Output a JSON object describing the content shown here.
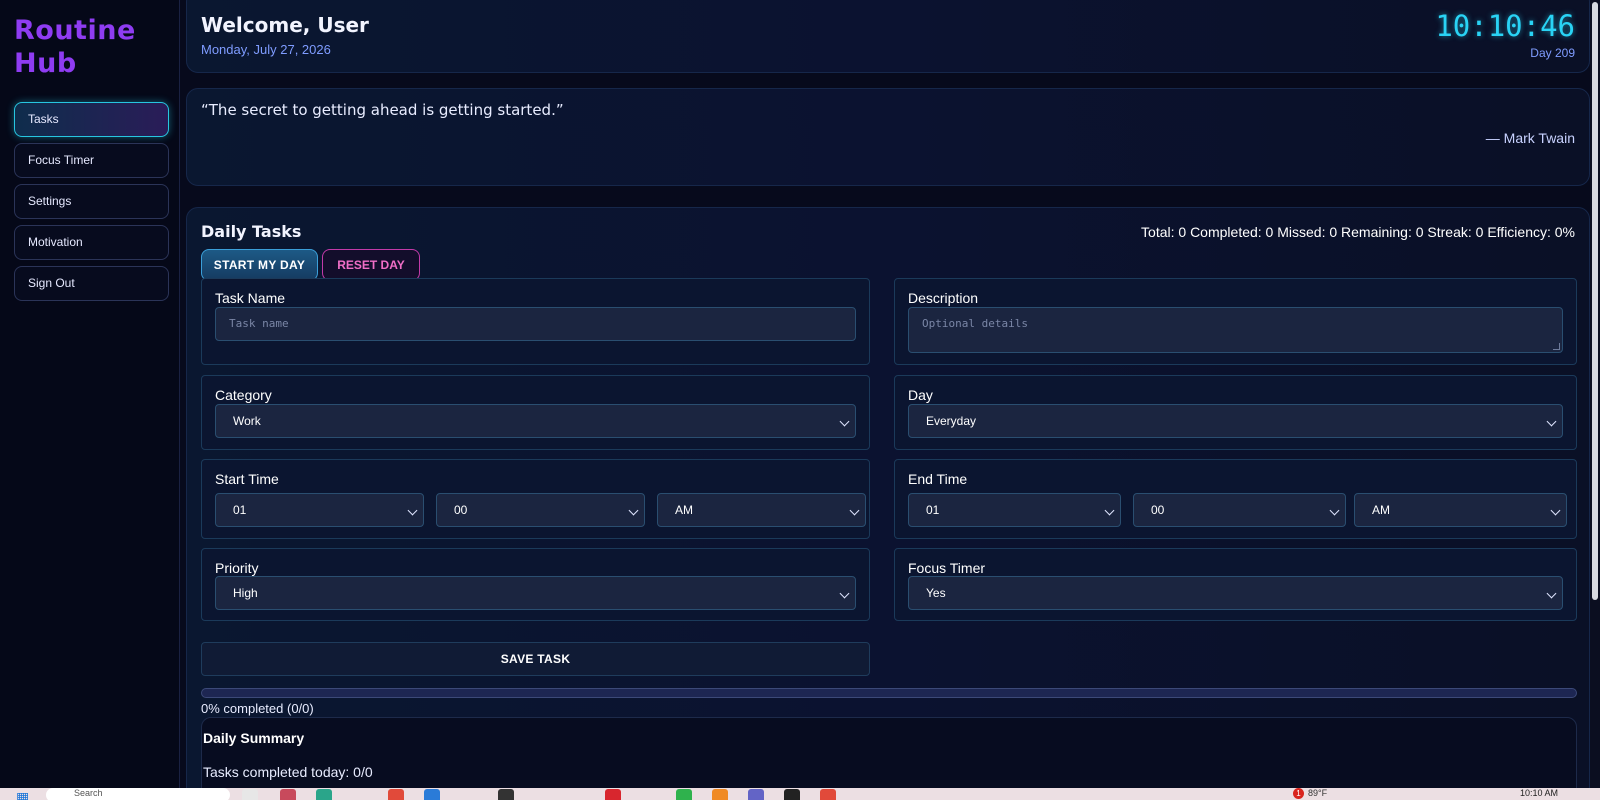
{
  "app": {
    "brand_line1": "Routine",
    "brand_line2": "Hub"
  },
  "sidebar": {
    "items": [
      {
        "label": "Tasks",
        "active": true
      },
      {
        "label": "Focus Timer"
      },
      {
        "label": "Settings"
      },
      {
        "label": "Motivation"
      },
      {
        "label": "Sign Out"
      }
    ]
  },
  "header": {
    "welcome": "Welcome, User",
    "date": "Monday, July 27, 2026",
    "clock": "10:10:46",
    "day": "Day 209"
  },
  "quote": {
    "text": "“The secret to getting ahead is getting started.”",
    "author": "— Mark Twain"
  },
  "tasks": {
    "title": "Daily Tasks",
    "stats": "Total: 0 Completed: 0 Missed: 0 Remaining: 0 Streak: 0 Efficiency: 0%",
    "start_label": "START MY DAY",
    "reset_label": "RESET DAY",
    "form": {
      "task_name": {
        "label": "Task Name",
        "placeholder": "Task name",
        "value": ""
      },
      "description": {
        "label": "Description",
        "placeholder": "Optional details",
        "value": ""
      },
      "category": {
        "label": "Category",
        "value": "Work"
      },
      "day": {
        "label": "Day",
        "value": "Everyday"
      },
      "start_time": {
        "label": "Start Time",
        "hour": "01",
        "minute": "00",
        "ampm": "AM"
      },
      "end_time": {
        "label": "End Time",
        "hour": "01",
        "minute": "00",
        "ampm": "AM"
      },
      "priority": {
        "label": "Priority",
        "value": "High"
      },
      "focus_timer": {
        "label": "Focus Timer",
        "value": "Yes"
      },
      "save_label": "SAVE TASK"
    },
    "progress": {
      "percent": 0,
      "text": "0% completed (0/0)"
    },
    "summary": {
      "title": "Daily Summary",
      "line": "Tasks completed today: 0/0"
    }
  },
  "taskbar": {
    "search_placeholder": "Search",
    "temperature": "89°F",
    "notification_count": "1",
    "time": "10:10 AM"
  },
  "colors": {
    "brand": "#8f3cf2",
    "accent": "#29d3f5",
    "reset": "#f06ec6",
    "background": "#070a1c"
  }
}
